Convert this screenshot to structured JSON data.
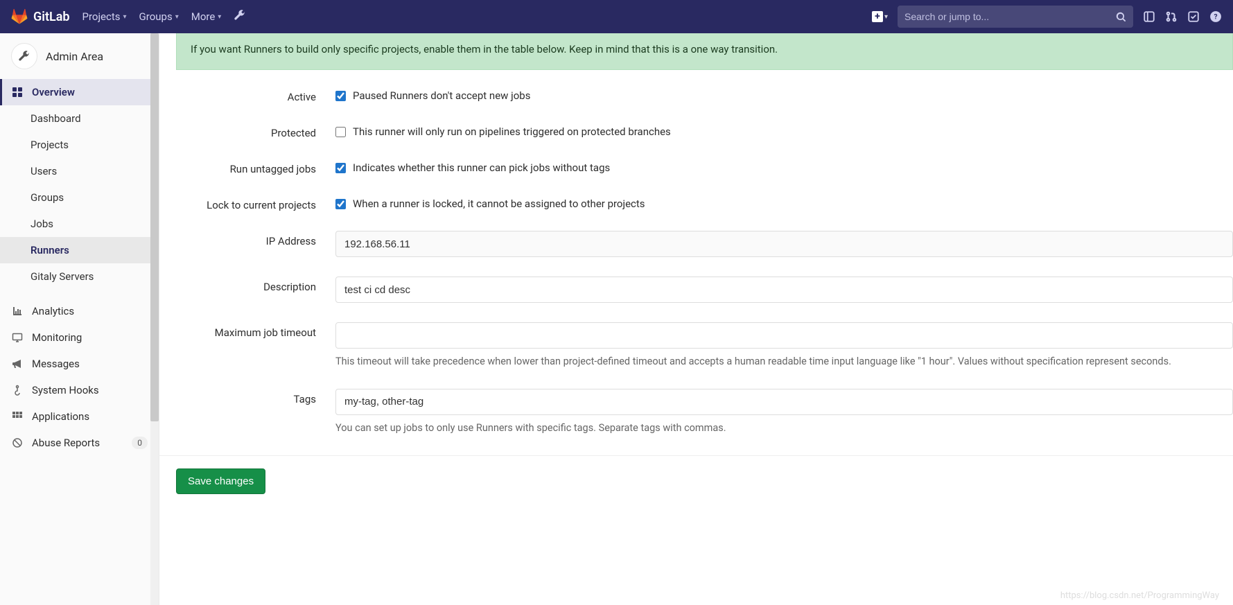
{
  "brand": "GitLab",
  "topnav": {
    "projects": "Projects",
    "groups": "Groups",
    "more": "More"
  },
  "search": {
    "placeholder": "Search or jump to..."
  },
  "sidebar": {
    "context": "Admin Area",
    "overview": "Overview",
    "items": {
      "dashboard": "Dashboard",
      "projects": "Projects",
      "users": "Users",
      "groups": "Groups",
      "jobs": "Jobs",
      "runners": "Runners",
      "gitaly": "Gitaly Servers"
    },
    "analytics": "Analytics",
    "monitoring": "Monitoring",
    "messages": "Messages",
    "system_hooks": "System Hooks",
    "applications": "Applications",
    "abuse": "Abuse Reports",
    "abuse_count": "0"
  },
  "alert": {
    "line": "If you want Runners to build only specific projects, enable them in the table below. Keep in mind that this is a one way transition."
  },
  "form": {
    "active": {
      "label": "Active",
      "desc": "Paused Runners don't accept new jobs",
      "checked": true
    },
    "protected": {
      "label": "Protected",
      "desc": "This runner will only run on pipelines triggered on protected branches",
      "checked": false
    },
    "untagged": {
      "label": "Run untagged jobs",
      "desc": "Indicates whether this runner can pick jobs without tags",
      "checked": true
    },
    "lock": {
      "label": "Lock to current projects",
      "desc": "When a runner is locked, it cannot be assigned to other projects",
      "checked": true
    },
    "ip": {
      "label": "IP Address",
      "value": "192.168.56.11"
    },
    "description": {
      "label": "Description",
      "value": "test ci cd desc"
    },
    "timeout": {
      "label": "Maximum job timeout",
      "value": "",
      "help": "This timeout will take precedence when lower than project-defined timeout and accepts a human readable time input language like \"1 hour\". Values without specification represent seconds."
    },
    "tags": {
      "label": "Tags",
      "value": "my-tag, other-tag",
      "help": "You can set up jobs to only use Runners with specific tags. Separate tags with commas."
    },
    "save": "Save changes"
  },
  "watermark": "https://blog.csdn.net/ProgrammingWay"
}
